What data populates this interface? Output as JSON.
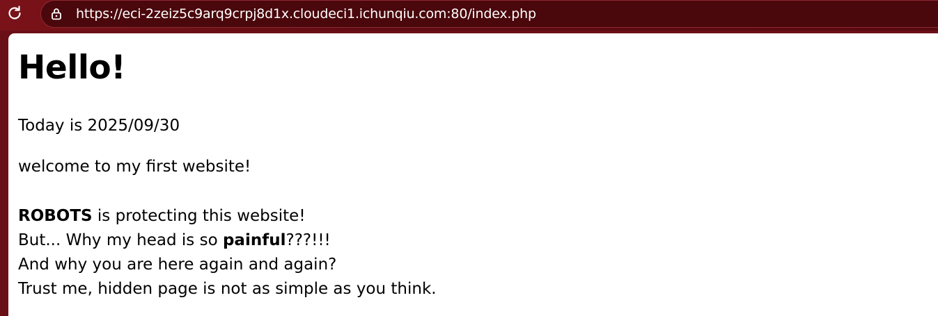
{
  "browser": {
    "url": "https://eci-2zeiz5c9arq9crpj8d1x.cloudeci1.ichunqiu.com:80/index.php",
    "reload_icon": "reload-icon",
    "lock_icon": "lock-icon",
    "colors": {
      "chrome_background": "#6b0f17",
      "address_bar": "#4a070c",
      "url_text": "#ffffff"
    }
  },
  "page": {
    "heading": "Hello!",
    "date_line": "Today is 2025/09/30",
    "welcome": "welcome to my first website!",
    "message": {
      "line1_bold": "ROBOTS",
      "line1_rest": " is protecting this website!",
      "line2_start": "But... Why my head is so ",
      "line2_bold": "painful",
      "line2_end": "???!!!",
      "line3": "And why you are here again and again?",
      "line4": "Trust me, hidden page is not as simple as you think."
    }
  }
}
